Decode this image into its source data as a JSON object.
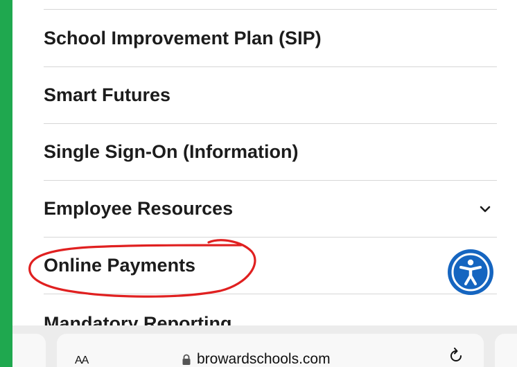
{
  "menu": {
    "items": [
      {
        "label": "School Improvement Plan (SIP)"
      },
      {
        "label": "Smart Futures"
      },
      {
        "label": "Single Sign-On (Information)"
      },
      {
        "label": "Employee Resources"
      },
      {
        "label": "Online Payments"
      }
    ],
    "cut_item_label": "Mandatory Reporting"
  },
  "browser": {
    "text_size_label": "AA",
    "url": "browardschools.com"
  },
  "icons": {
    "expand": "chevron-down-icon",
    "accessibility": "accessibility-icon",
    "lock": "lock-icon",
    "reload": "reload-icon"
  },
  "colors": {
    "background_frame": "#1fa84f",
    "accessibility_button": "#1565c0",
    "annotation_circle": "#e02020"
  }
}
